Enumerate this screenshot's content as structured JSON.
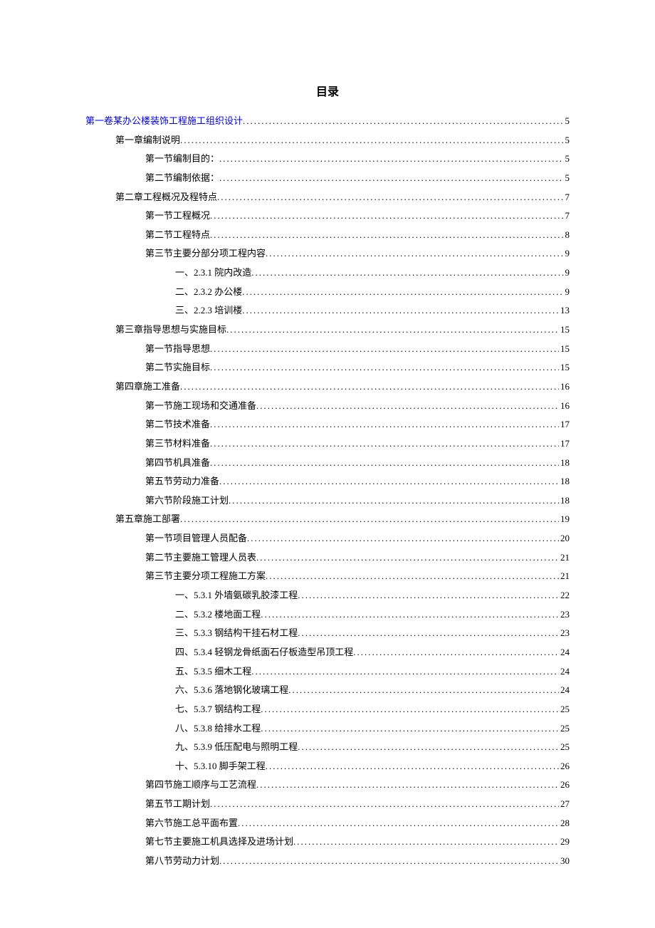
{
  "title": "目录",
  "toc": [
    {
      "level": 0,
      "text": "第一卷某办公楼装饰工程施工组织设计",
      "page": "5",
      "blue": true
    },
    {
      "level": 1,
      "text": "第一章编制说明",
      "page": "5",
      "blue": false
    },
    {
      "level": 2,
      "text": "第一节编制目的：",
      "page": "5",
      "blue": false
    },
    {
      "level": 2,
      "text": "第二节编制依据：",
      "page": "5",
      "blue": false
    },
    {
      "level": 1,
      "text": "第二章工程概况及程特点",
      "page": "7",
      "blue": false
    },
    {
      "level": 2,
      "text": "第一节工程概况",
      "page": "7",
      "blue": false
    },
    {
      "level": 2,
      "text": "第二节工程特点",
      "page": "8",
      "blue": false
    },
    {
      "level": 2,
      "text": "第三节主要分部分项工程内容",
      "page": "9",
      "blue": false
    },
    {
      "level": 3,
      "text": "一、2.3.1 院内改造",
      "page": "9",
      "blue": false
    },
    {
      "level": 3,
      "text": "二、2.3.2 办公楼",
      "page": "9",
      "blue": false
    },
    {
      "level": 3,
      "text": "三、2.2.3 培训楼",
      "page": "13",
      "blue": false
    },
    {
      "level": 1,
      "text": "第三章指导思想与实施目标",
      "page": "15",
      "blue": false
    },
    {
      "level": 2,
      "text": "第一节指导思想",
      "page": "15",
      "blue": false
    },
    {
      "level": 2,
      "text": "第二节实施目标",
      "page": "15",
      "blue": false
    },
    {
      "level": 1,
      "text": "第四章施工准备",
      "page": "16",
      "blue": false
    },
    {
      "level": 2,
      "text": "第一节施工现场和交通准备",
      "page": "16",
      "blue": false
    },
    {
      "level": 2,
      "text": "第二节技术准备",
      "page": "17",
      "blue": false
    },
    {
      "level": 2,
      "text": "第三节材料准备",
      "page": "17",
      "blue": false
    },
    {
      "level": 2,
      "text": "第四节机具准备",
      "page": "18",
      "blue": false
    },
    {
      "level": 2,
      "text": "第五节劳动力准备",
      "page": "18",
      "blue": false
    },
    {
      "level": 2,
      "text": "第六节阶段施工计划",
      "page": "18",
      "blue": false
    },
    {
      "level": 1,
      "text": "第五章施工部署",
      "page": "19",
      "blue": false
    },
    {
      "level": 2,
      "text": "第一节项目管理人员配备",
      "page": "20",
      "blue": false
    },
    {
      "level": 2,
      "text": "第二节主要施工管理人员表",
      "page": "21",
      "blue": false
    },
    {
      "level": 2,
      "text": "第三节主要分项工程施工方案",
      "page": "21",
      "blue": false
    },
    {
      "level": 3,
      "text": "一、5.3.1 外墙氨碳乳胶漆工程",
      "page": "22",
      "blue": false
    },
    {
      "level": 3,
      "text": "二、5.3.2 楼地面工程",
      "page": "23",
      "blue": false
    },
    {
      "level": 3,
      "text": "三、5.3.3 钢结构干挂石材工程",
      "page": "23",
      "blue": false
    },
    {
      "level": 3,
      "text": "四、5.3.4 轻钢龙骨纸面石仔板造型吊顶工程",
      "page": "24",
      "blue": false
    },
    {
      "level": 3,
      "text": "五、5.3.5 细木工程",
      "page": "24",
      "blue": false
    },
    {
      "level": 3,
      "text": "六、5.3.6 落地钢化玻璃工程",
      "page": "24",
      "blue": false
    },
    {
      "level": 3,
      "text": "七、5.3.7 钢结构工程",
      "page": "25",
      "blue": false
    },
    {
      "level": 3,
      "text": "八、5.3.8 给排水工程",
      "page": "25",
      "blue": false
    },
    {
      "level": 3,
      "text": "九、5.3.9 低压配电与照明工程",
      "page": "25",
      "blue": false
    },
    {
      "level": 3,
      "text": "十、5.3.10 脚手架工程",
      "page": "26",
      "blue": false
    },
    {
      "level": 2,
      "text": "第四节施工顺序与工艺流程",
      "page": "26",
      "blue": false
    },
    {
      "level": 2,
      "text": "第五节工期计划",
      "page": "27",
      "blue": false
    },
    {
      "level": 2,
      "text": "第六节施工总平面布置",
      "page": "28",
      "blue": false
    },
    {
      "level": 2,
      "text": "第七节主要施工机具选择及进场计划",
      "page": "29",
      "blue": false
    },
    {
      "level": 2,
      "text": "第八节劳动力计划",
      "page": "30",
      "blue": false
    }
  ]
}
